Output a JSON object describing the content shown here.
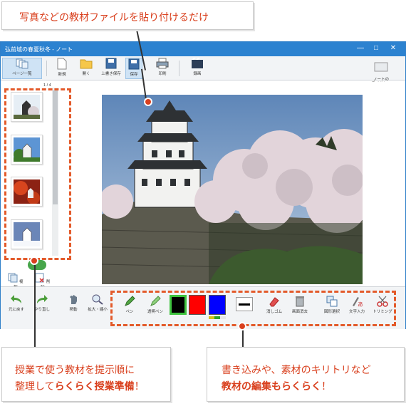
{
  "callouts": {
    "top": "写真などの教材ファイルを貼り付けるだけ",
    "left_line1": "授業で使う教材を提示順に",
    "left_line2_plain": "整理して",
    "left_line2_bold": "らくらく授業準備",
    "left_line2_end": "！",
    "right_line1": "書き込みや、素材のキリトリなど",
    "right_line2_bold": "教材の編集もらくらく",
    "right_line2_end": "！"
  },
  "window": {
    "title": "弘前城の春夏秋冬 - ノート",
    "controls": [
      "—",
      "□",
      "✕"
    ]
  },
  "toolbar": {
    "page_list": "ページ一覧",
    "new": "新規",
    "open": "開く",
    "overwrite_save": "上書き保存",
    "save": "保存",
    "print": "印刷",
    "record": "録画",
    "slideshow": "ノートの\nスライドショー"
  },
  "pagelist": {
    "page_indicator": "1 / 4",
    "add": "複製",
    "delete": "削除"
  },
  "bottom": {
    "undo": "元に戻す",
    "redo": "やり直し",
    "move": "移動",
    "zoom": "拡大・縮小",
    "pen": "ペン",
    "highlighter": "透明ペン",
    "eraser": "消しゴム",
    "clear": "画面消去",
    "select": "図形選択",
    "text": "文字入力",
    "trim": "トリミング"
  },
  "colors": {
    "accent": "#d9401e",
    "title_bar": "#2c82d0",
    "dash": "#e35a2a",
    "swatch_black": "#000000",
    "swatch_red": "#ff0000",
    "swatch_blue": "#0000ff"
  },
  "icons": [
    "page-list-icon",
    "new-file-icon",
    "open-folder-icon",
    "save-icon",
    "save-as-icon",
    "print-icon",
    "record-icon",
    "slideshow-icon",
    "undo-icon",
    "redo-icon",
    "move-icon",
    "zoom-icon",
    "pen-icon",
    "highlighter-icon",
    "eraser-icon",
    "clear-icon",
    "select-icon",
    "text-icon",
    "trim-icon"
  ]
}
